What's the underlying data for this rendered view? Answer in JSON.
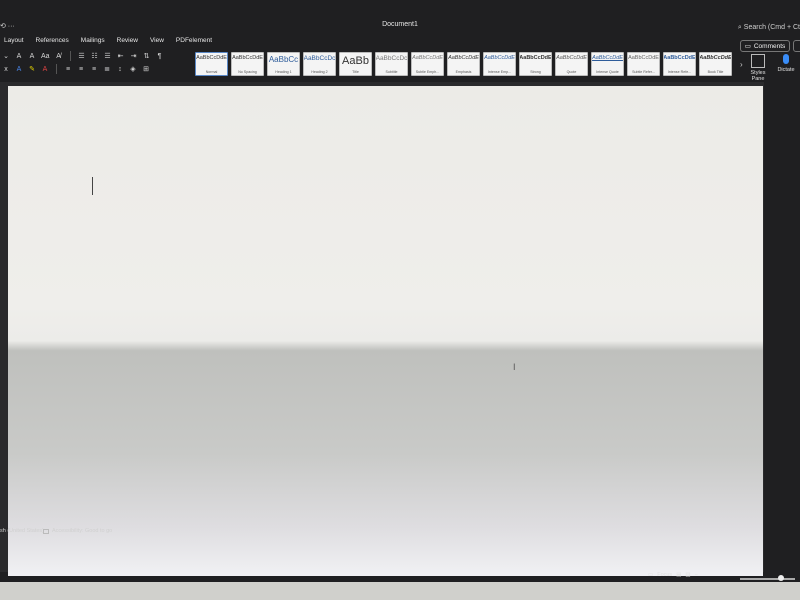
{
  "window": {
    "title": "Document1",
    "search_placeholder": "Search (Cmd + Ct"
  },
  "menu_tabs": [
    "Layout",
    "References",
    "Mailings",
    "Review",
    "View",
    "PDFelement"
  ],
  "toolbar": {
    "comments_label": "Comments",
    "styles_pane_label": "Styles Pane",
    "dictate_label": "Dictate"
  },
  "styles": [
    {
      "sample": "AaBbCcDdE",
      "name": "Normal"
    },
    {
      "sample": "AaBbCcDdE",
      "name": "No Spacing"
    },
    {
      "sample": "AaBbCc",
      "name": "Heading 1"
    },
    {
      "sample": "AaBbCcDc",
      "name": "Heading 2"
    },
    {
      "sample": "AaBb",
      "name": "Title"
    },
    {
      "sample": "AaBbCcDc",
      "name": "Subtitle"
    },
    {
      "sample": "AaBbCcDdE",
      "name": "Subtle Emph..."
    },
    {
      "sample": "AaBbCcDdE",
      "name": "Emphasis"
    },
    {
      "sample": "AaBbCcDdE",
      "name": "Intense Emp..."
    },
    {
      "sample": "AaBbCcDdE",
      "name": "Strong"
    },
    {
      "sample": "AaBbCcDdE",
      "name": "Quote"
    },
    {
      "sample": "AaBbCcDdE",
      "name": "Intense Quote"
    },
    {
      "sample": "AaBbCcDdE",
      "name": "Subtle Refer..."
    },
    {
      "sample": "AaBbCcDdE",
      "name": "Intense Refe..."
    },
    {
      "sample": "AaBbCcDdE",
      "name": "Book Title"
    }
  ],
  "status": {
    "language": "sh (United States)",
    "accessibility": "Accessibility: Good to go",
    "focus": "Focus"
  }
}
